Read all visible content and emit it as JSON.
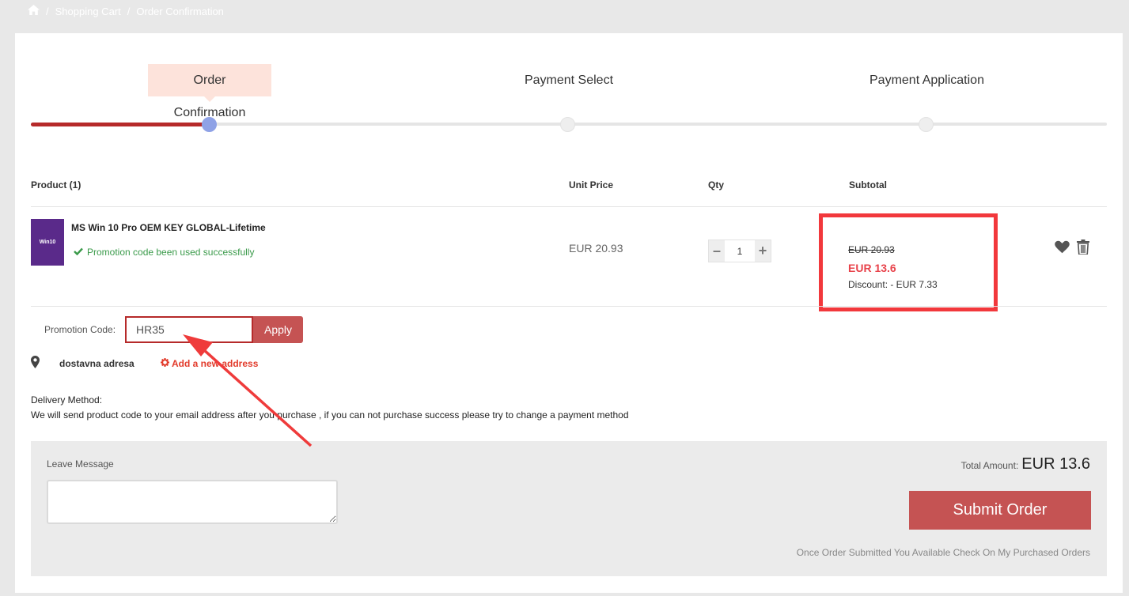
{
  "breadcrumb": {
    "items": [
      "Shopping Cart",
      "Order Confirmation"
    ],
    "separator": "/"
  },
  "steps": [
    {
      "label": "Order Confirmation",
      "active": true
    },
    {
      "label": "Payment Select",
      "active": false
    },
    {
      "label": "Payment Application",
      "active": false
    }
  ],
  "progress": {
    "completed_fraction": 0.17
  },
  "table": {
    "headers": {
      "product": "Product (1)",
      "unit_price": "Unit Price",
      "qty": "Qty",
      "subtotal": "Subtotal"
    }
  },
  "product": {
    "thumb_text": "Win10",
    "name": "MS Win 10 Pro OEM KEY GLOBAL-Lifetime",
    "promo_status": "Promotion code been used successfully",
    "unit_price": "EUR 20.93",
    "qty": "1",
    "old_price": "EUR 20.93",
    "new_price": "EUR 13.6",
    "discount": "Discount: - EUR 7.33"
  },
  "promo": {
    "label": "Promotion Code:",
    "value": "HR35",
    "apply_label": "Apply"
  },
  "address": {
    "name": "dostavna adresa",
    "add_label": "Add a new address"
  },
  "delivery": {
    "title": "Delivery Method:",
    "text": "We will send product code to your email address after you purchase , if you can not purchase success please try to change a payment method"
  },
  "order": {
    "message_label": "Leave Message",
    "total_label": "Total Amount:",
    "total_value": "EUR 13.6",
    "submit_label": "Submit Order",
    "note": "Once Order Submitted You Available Check On My Purchased Orders"
  },
  "colors": {
    "accent": "#b62a2a",
    "button": "#c55353",
    "highlight": "#f2383c",
    "price_red": "#e8434b",
    "success": "#3a9a4a",
    "active_dot": "#8fa2e6"
  }
}
